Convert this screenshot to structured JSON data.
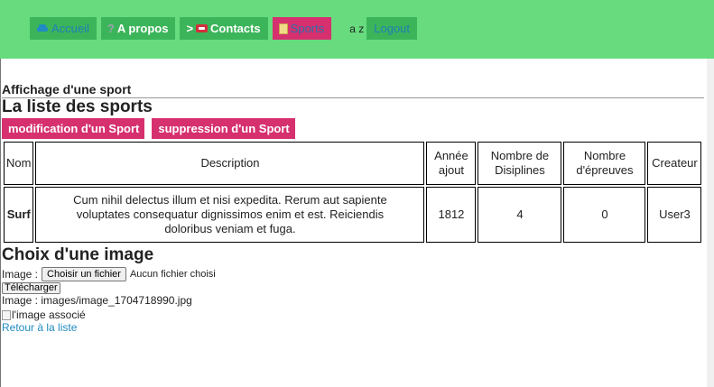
{
  "nav": {
    "accueil": "Accueil",
    "apropos": "A propos",
    "contacts_prefix": ">",
    "contacts": "Contacts",
    "sports": "Sports",
    "az": "a z",
    "logout": "Logout"
  },
  "page": {
    "title": "Affichage d'une sport",
    "list_title": "La liste des sports",
    "modify_button": "modification d'un Sport",
    "delete_button": "suppression d'un Sport"
  },
  "table": {
    "headers": {
      "nom": "Nom",
      "description": "Description",
      "annee_l1": "Année",
      "annee_l2": "ajout",
      "nb_disc_l1": "Nombre de",
      "nb_disc_l2": "Disiplines",
      "nb_epr_l1": "Nombre",
      "nb_epr_l2": "d'épreuves",
      "createur": "Createur"
    },
    "row": {
      "nom": "Surf",
      "description_l1": "Cum nihil delectus illum et nisi expedita. Rerum aut sapiente",
      "description_l2": "voluptates consequatur dignissimos enim et est. Reiciendis",
      "description_l3": "doloribus veniam et fuga.",
      "annee": "1812",
      "nb_disciplines": "4",
      "nb_epreuves": "0",
      "createur": "User3"
    }
  },
  "image_section": {
    "title": "Choix d'une image",
    "image_label": "Image :",
    "choose_file": "Choisir un fichier",
    "no_file": "Aucun fichier choisi",
    "upload": "Télécharger",
    "path": "Image : images/image_1704718990.jpg",
    "alt": "l'image associé",
    "back_link": "Retour à la liste"
  },
  "colors": {
    "topbar": "#67db7d",
    "nav_green": "#3cb55a",
    "accent_pink": "#d6306f",
    "link_blue": "#1f8bc2"
  }
}
